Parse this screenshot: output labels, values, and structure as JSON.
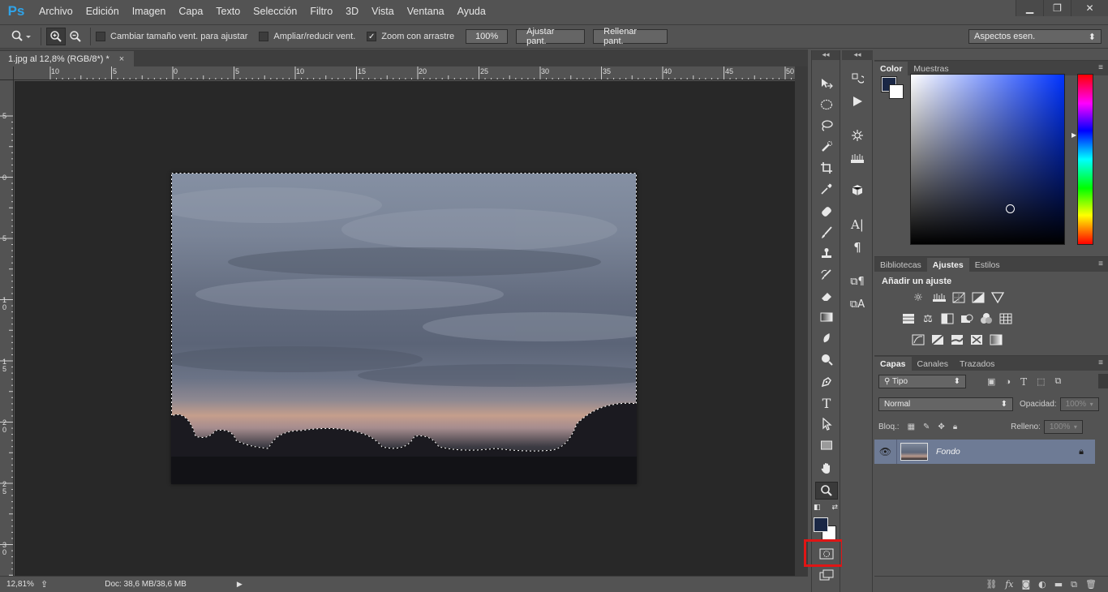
{
  "app": {
    "logo": "Ps"
  },
  "menu": [
    "Archivo",
    "Edición",
    "Imagen",
    "Capa",
    "Texto",
    "Selección",
    "Filtro",
    "3D",
    "Vista",
    "Ventana",
    "Ayuda"
  ],
  "window_controls": {
    "minimize": "▁",
    "restore": "❐",
    "close": "✕"
  },
  "options": {
    "tool_icon": "zoom-icon",
    "resize_windows_label": "Cambiar tamaño vent. para ajustar",
    "zoom_all_windows_label": "Ampliar/reducir vent.",
    "scrubby_zoom_label": "Zoom con arrastre",
    "scrubby_zoom_checked": "✓",
    "zoom_100_label": "100%",
    "fit_screen_label": "Ajustar pant.",
    "fill_screen_label": "Rellenar pant.",
    "workspace_label": "Aspectos esen."
  },
  "document": {
    "tab_title": "1.jpg al 12,8% (RGB/8*) *",
    "tab_close": "×"
  },
  "rulers": {
    "horizontal": [
      "10",
      "5",
      "0",
      "5",
      "10",
      "15",
      "20",
      "25",
      "30",
      "35",
      "40",
      "45",
      "50"
    ],
    "vertical": [
      "5",
      "0",
      "5",
      "1 0",
      "1 5",
      "2 0",
      "2 5",
      "3 0"
    ]
  },
  "status": {
    "zoom": "12,81%",
    "doc_size": "Doc: 38,6 MB/38,6 MB"
  },
  "tools": [
    "move-tool",
    "marquee-tool",
    "lasso-tool",
    "quick-selection-tool",
    "crop-tool",
    "eyedropper-tool",
    "healing-brush-tool",
    "brush-tool",
    "clone-stamp-tool",
    "history-brush-tool",
    "eraser-tool",
    "gradient-tool",
    "blur-tool",
    "dodge-tool",
    "pen-tool",
    "type-tool",
    "path-selection-tool",
    "rectangle-tool",
    "hand-tool",
    "zoom-tool"
  ],
  "tools_active": "zoom-tool",
  "quick_mask_highlight_color": "#e01515",
  "colors": {
    "foreground": "#1a2745",
    "background": "#ffffff"
  },
  "color_panel": {
    "tabs": [
      "Color",
      "Muestras"
    ],
    "active": "Color"
  },
  "adjust_panel": {
    "tabs": [
      "Bibliotecas",
      "Ajustes",
      "Estilos"
    ],
    "active": "Ajustes",
    "title": "Añadir un ajuste"
  },
  "layers_panel": {
    "tabs": [
      "Capas",
      "Canales",
      "Trazados"
    ],
    "active": "Capas",
    "filter_label": "Tipo",
    "blend_mode": "Normal",
    "opacity_label": "Opacidad:",
    "opacity_value": "100%",
    "lock_label": "Bloq.:",
    "fill_label": "Relleno:",
    "fill_value": "100%",
    "layers": [
      {
        "name": "Fondo",
        "visible": true,
        "locked": true
      }
    ]
  }
}
